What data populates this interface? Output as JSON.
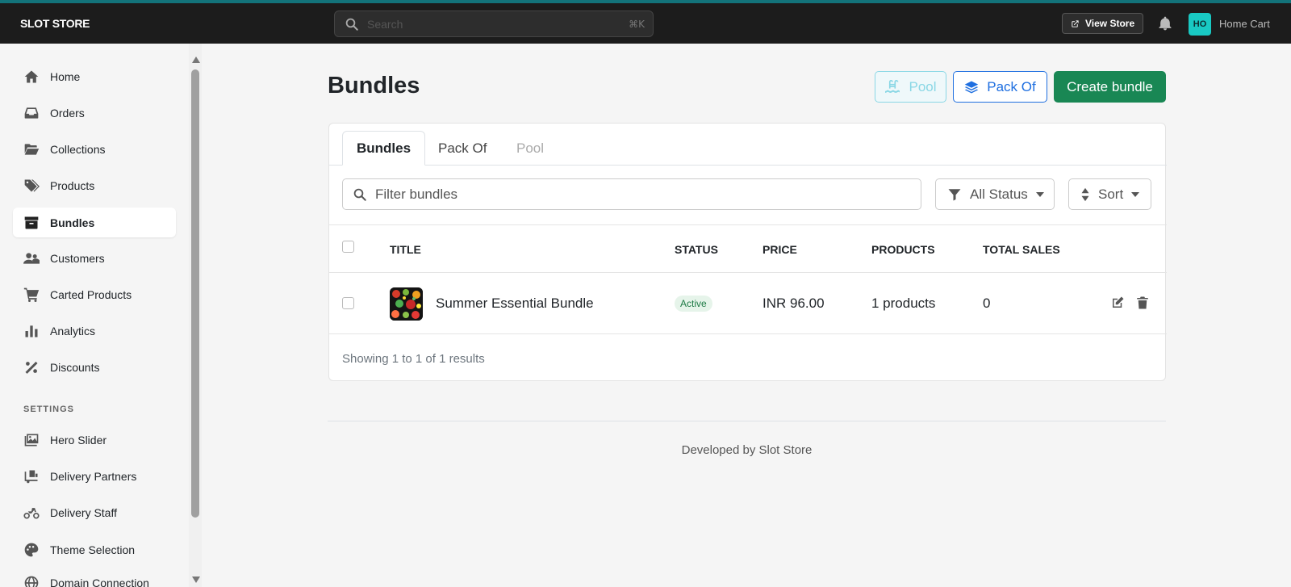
{
  "header": {
    "brand": "SLOT STORE",
    "search_placeholder": "Search",
    "search_shortcut": "⌘K",
    "view_store_label": "View Store",
    "avatar_initials": "HO",
    "user_name": "Home Cart"
  },
  "sidebar": {
    "items": [
      {
        "label": "Home",
        "icon": "home-icon"
      },
      {
        "label": "Orders",
        "icon": "inbox-icon"
      },
      {
        "label": "Collections",
        "icon": "folder-open-icon"
      },
      {
        "label": "Products",
        "icon": "tags-icon"
      },
      {
        "label": "Bundles",
        "icon": "archive-box-icon",
        "active": true
      },
      {
        "label": "Customers",
        "icon": "users-icon"
      },
      {
        "label": "Carted Products",
        "icon": "cart-icon"
      },
      {
        "label": "Analytics",
        "icon": "bar-chart-icon"
      },
      {
        "label": "Discounts",
        "icon": "percent-icon"
      }
    ],
    "settings_label": "SETTINGS",
    "settings_items": [
      {
        "label": "Hero Slider",
        "icon": "images-icon"
      },
      {
        "label": "Delivery Partners",
        "icon": "truck-ramp-icon"
      },
      {
        "label": "Delivery Staff",
        "icon": "motorcycle-icon"
      },
      {
        "label": "Theme Selection",
        "icon": "palette-icon"
      },
      {
        "label": "Domain Connection",
        "icon": "globe-icon"
      }
    ]
  },
  "main": {
    "title": "Bundles",
    "buttons": {
      "pool": "Pool",
      "pack_of": "Pack Of",
      "create": "Create bundle"
    },
    "tabs": [
      "Bundles",
      "Pack Of",
      "Pool"
    ],
    "filter_placeholder": "Filter bundles",
    "status_filter": "All Status",
    "sort_label": "Sort",
    "table": {
      "columns": [
        "TITLE",
        "STATUS",
        "PRICE",
        "PRODUCTS",
        "TOTAL SALES"
      ],
      "rows": [
        {
          "title": "Summer Essential Bundle",
          "status": "Active",
          "price": "INR 96.00",
          "products": "1 products",
          "total_sales": "0"
        }
      ]
    },
    "results_text": "Showing 1 to 1 of 1 results"
  },
  "footer": {
    "text": "Developed by Slot Store"
  },
  "colors": {
    "topbar": "#1c1c1c",
    "accent_line": "#13737a",
    "primary_blue": "#1f6fe0",
    "success_green": "#198754",
    "info_cyan": "#8ad7e5",
    "avatar_bg": "#19c9c3"
  }
}
